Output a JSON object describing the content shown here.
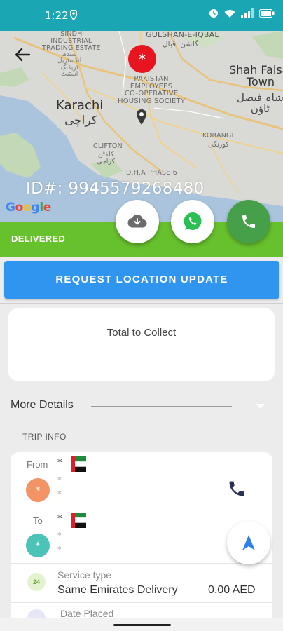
{
  "status_bar": {
    "time": "1:22"
  },
  "map": {
    "labels": {
      "industrial": "SINDH\nINDUSTRIAL\nTRADING ESTATE",
      "industrial_urdu": "سندھ\nانڈسٹریل\nٹریڈنگ\nاسٹیٹ",
      "gulshan": "GULSHAN-E-IQBAL",
      "gulshan_urdu": "گلشن اقبال",
      "shah_faisal": "Shah Faisal\nTown",
      "shah_faisal_urdu": "شاہ فیصل\nٹاؤن",
      "karachi": "Karachi",
      "karachi_urdu": "کراچی",
      "pechs": "PAKISTAN\nEMPLOYEES\nCO-OPERATIVE\nHOUSING SOCIETY",
      "korangi": "KORANGI",
      "korangi_urdu": "کورنگی",
      "clifton": "CLIFTON",
      "clifton_urdu": "کلفٹن\nکراچی",
      "dha": "D.H.A PHASE 6"
    },
    "pin_symbol": "*",
    "order_id": "ID#: 9945579268480",
    "attribution": [
      "G",
      "o",
      "o",
      "g",
      "l",
      "e"
    ]
  },
  "status": {
    "label": "DELIVERED"
  },
  "request_button": {
    "label": "REQUEST LOCATION UPDATE"
  },
  "collect_card": {
    "title": "Total to Collect"
  },
  "more_details": {
    "label": "More Details"
  },
  "trip_info": {
    "heading": "TRIP INFO",
    "from": {
      "label": "From",
      "name": "*",
      "lines": [
        "*",
        "*"
      ],
      "marker": "*"
    },
    "to": {
      "label": "To",
      "name": "*",
      "lines": [
        "*",
        "*"
      ],
      "marker": "*"
    },
    "service": {
      "badge": "24",
      "label": "Service type",
      "value": "Same Emirates Delivery",
      "price": "0.00 AED"
    },
    "date": {
      "label": "Date Placed"
    }
  },
  "colors": {
    "status_bar": "#1aa6b2",
    "delivered": "#67c12d",
    "primary_button": "#2f95ee",
    "call_green": "#46a04a",
    "pin_red": "#e8141f"
  }
}
